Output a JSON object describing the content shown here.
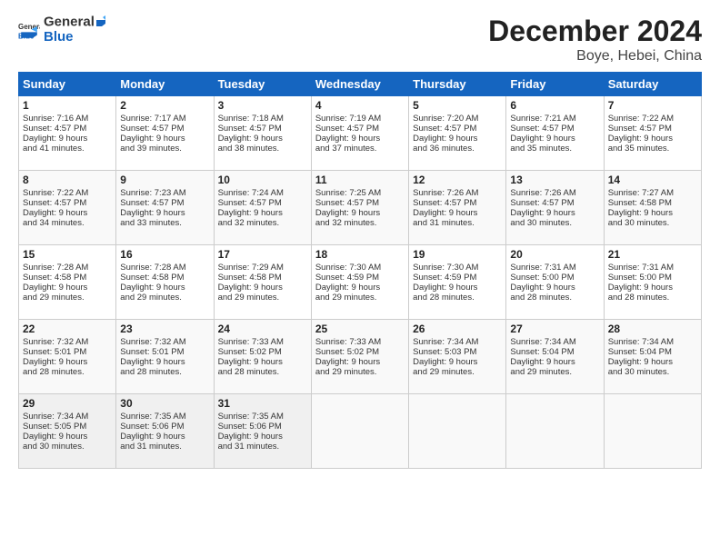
{
  "header": {
    "logo_general": "General",
    "logo_blue": "Blue",
    "month_year": "December 2024",
    "location": "Boye, Hebei, China"
  },
  "weekdays": [
    "Sunday",
    "Monday",
    "Tuesday",
    "Wednesday",
    "Thursday",
    "Friday",
    "Saturday"
  ],
  "weeks": [
    [
      {
        "day": "1",
        "lines": [
          "Sunrise: 7:16 AM",
          "Sunset: 4:57 PM",
          "Daylight: 9 hours",
          "and 41 minutes."
        ]
      },
      {
        "day": "2",
        "lines": [
          "Sunrise: 7:17 AM",
          "Sunset: 4:57 PM",
          "Daylight: 9 hours",
          "and 39 minutes."
        ]
      },
      {
        "day": "3",
        "lines": [
          "Sunrise: 7:18 AM",
          "Sunset: 4:57 PM",
          "Daylight: 9 hours",
          "and 38 minutes."
        ]
      },
      {
        "day": "4",
        "lines": [
          "Sunrise: 7:19 AM",
          "Sunset: 4:57 PM",
          "Daylight: 9 hours",
          "and 37 minutes."
        ]
      },
      {
        "day": "5",
        "lines": [
          "Sunrise: 7:20 AM",
          "Sunset: 4:57 PM",
          "Daylight: 9 hours",
          "and 36 minutes."
        ]
      },
      {
        "day": "6",
        "lines": [
          "Sunrise: 7:21 AM",
          "Sunset: 4:57 PM",
          "Daylight: 9 hours",
          "and 35 minutes."
        ]
      },
      {
        "day": "7",
        "lines": [
          "Sunrise: 7:22 AM",
          "Sunset: 4:57 PM",
          "Daylight: 9 hours",
          "and 35 minutes."
        ]
      }
    ],
    [
      {
        "day": "8",
        "lines": [
          "Sunrise: 7:22 AM",
          "Sunset: 4:57 PM",
          "Daylight: 9 hours",
          "and 34 minutes."
        ]
      },
      {
        "day": "9",
        "lines": [
          "Sunrise: 7:23 AM",
          "Sunset: 4:57 PM",
          "Daylight: 9 hours",
          "and 33 minutes."
        ]
      },
      {
        "day": "10",
        "lines": [
          "Sunrise: 7:24 AM",
          "Sunset: 4:57 PM",
          "Daylight: 9 hours",
          "and 32 minutes."
        ]
      },
      {
        "day": "11",
        "lines": [
          "Sunrise: 7:25 AM",
          "Sunset: 4:57 PM",
          "Daylight: 9 hours",
          "and 32 minutes."
        ]
      },
      {
        "day": "12",
        "lines": [
          "Sunrise: 7:26 AM",
          "Sunset: 4:57 PM",
          "Daylight: 9 hours",
          "and 31 minutes."
        ]
      },
      {
        "day": "13",
        "lines": [
          "Sunrise: 7:26 AM",
          "Sunset: 4:57 PM",
          "Daylight: 9 hours",
          "and 30 minutes."
        ]
      },
      {
        "day": "14",
        "lines": [
          "Sunrise: 7:27 AM",
          "Sunset: 4:58 PM",
          "Daylight: 9 hours",
          "and 30 minutes."
        ]
      }
    ],
    [
      {
        "day": "15",
        "lines": [
          "Sunrise: 7:28 AM",
          "Sunset: 4:58 PM",
          "Daylight: 9 hours",
          "and 29 minutes."
        ]
      },
      {
        "day": "16",
        "lines": [
          "Sunrise: 7:28 AM",
          "Sunset: 4:58 PM",
          "Daylight: 9 hours",
          "and 29 minutes."
        ]
      },
      {
        "day": "17",
        "lines": [
          "Sunrise: 7:29 AM",
          "Sunset: 4:58 PM",
          "Daylight: 9 hours",
          "and 29 minutes."
        ]
      },
      {
        "day": "18",
        "lines": [
          "Sunrise: 7:30 AM",
          "Sunset: 4:59 PM",
          "Daylight: 9 hours",
          "and 29 minutes."
        ]
      },
      {
        "day": "19",
        "lines": [
          "Sunrise: 7:30 AM",
          "Sunset: 4:59 PM",
          "Daylight: 9 hours",
          "and 28 minutes."
        ]
      },
      {
        "day": "20",
        "lines": [
          "Sunrise: 7:31 AM",
          "Sunset: 5:00 PM",
          "Daylight: 9 hours",
          "and 28 minutes."
        ]
      },
      {
        "day": "21",
        "lines": [
          "Sunrise: 7:31 AM",
          "Sunset: 5:00 PM",
          "Daylight: 9 hours",
          "and 28 minutes."
        ]
      }
    ],
    [
      {
        "day": "22",
        "lines": [
          "Sunrise: 7:32 AM",
          "Sunset: 5:01 PM",
          "Daylight: 9 hours",
          "and 28 minutes."
        ]
      },
      {
        "day": "23",
        "lines": [
          "Sunrise: 7:32 AM",
          "Sunset: 5:01 PM",
          "Daylight: 9 hours",
          "and 28 minutes."
        ]
      },
      {
        "day": "24",
        "lines": [
          "Sunrise: 7:33 AM",
          "Sunset: 5:02 PM",
          "Daylight: 9 hours",
          "and 28 minutes."
        ]
      },
      {
        "day": "25",
        "lines": [
          "Sunrise: 7:33 AM",
          "Sunset: 5:02 PM",
          "Daylight: 9 hours",
          "and 29 minutes."
        ]
      },
      {
        "day": "26",
        "lines": [
          "Sunrise: 7:34 AM",
          "Sunset: 5:03 PM",
          "Daylight: 9 hours",
          "and 29 minutes."
        ]
      },
      {
        "day": "27",
        "lines": [
          "Sunrise: 7:34 AM",
          "Sunset: 5:04 PM",
          "Daylight: 9 hours",
          "and 29 minutes."
        ]
      },
      {
        "day": "28",
        "lines": [
          "Sunrise: 7:34 AM",
          "Sunset: 5:04 PM",
          "Daylight: 9 hours",
          "and 30 minutes."
        ]
      }
    ],
    [
      {
        "day": "29",
        "lines": [
          "Sunrise: 7:34 AM",
          "Sunset: 5:05 PM",
          "Daylight: 9 hours",
          "and 30 minutes."
        ]
      },
      {
        "day": "30",
        "lines": [
          "Sunrise: 7:35 AM",
          "Sunset: 5:06 PM",
          "Daylight: 9 hours",
          "and 31 minutes."
        ]
      },
      {
        "day": "31",
        "lines": [
          "Sunrise: 7:35 AM",
          "Sunset: 5:06 PM",
          "Daylight: 9 hours",
          "and 31 minutes."
        ]
      },
      {
        "day": "",
        "lines": []
      },
      {
        "day": "",
        "lines": []
      },
      {
        "day": "",
        "lines": []
      },
      {
        "day": "",
        "lines": []
      }
    ]
  ]
}
